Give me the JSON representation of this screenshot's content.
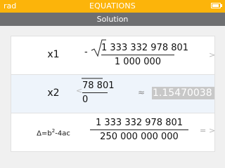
{
  "status_bar": {
    "mode": "rad",
    "title": "EQUATIONS"
  },
  "header": {
    "title": "Solution"
  },
  "rows": [
    {
      "label": "x1",
      "sign": "-",
      "numerator": "1 333 332 978 801",
      "denominator": "1 000 000",
      "scroll_indicator": ">"
    },
    {
      "label": "x2",
      "left_indicator": "<",
      "numerator_visible": "78 801",
      "denominator_visible": "0",
      "approx_symbol": "≈",
      "approx_value": "1.15470038"
    },
    {
      "label_base": "Δ=b",
      "label_exp": "2",
      "label_rest": "-4ac",
      "numerator": "1 333 332 978 801",
      "denominator": "250 000 000 000",
      "equals": "=",
      "scroll_indicator": ">"
    }
  ]
}
